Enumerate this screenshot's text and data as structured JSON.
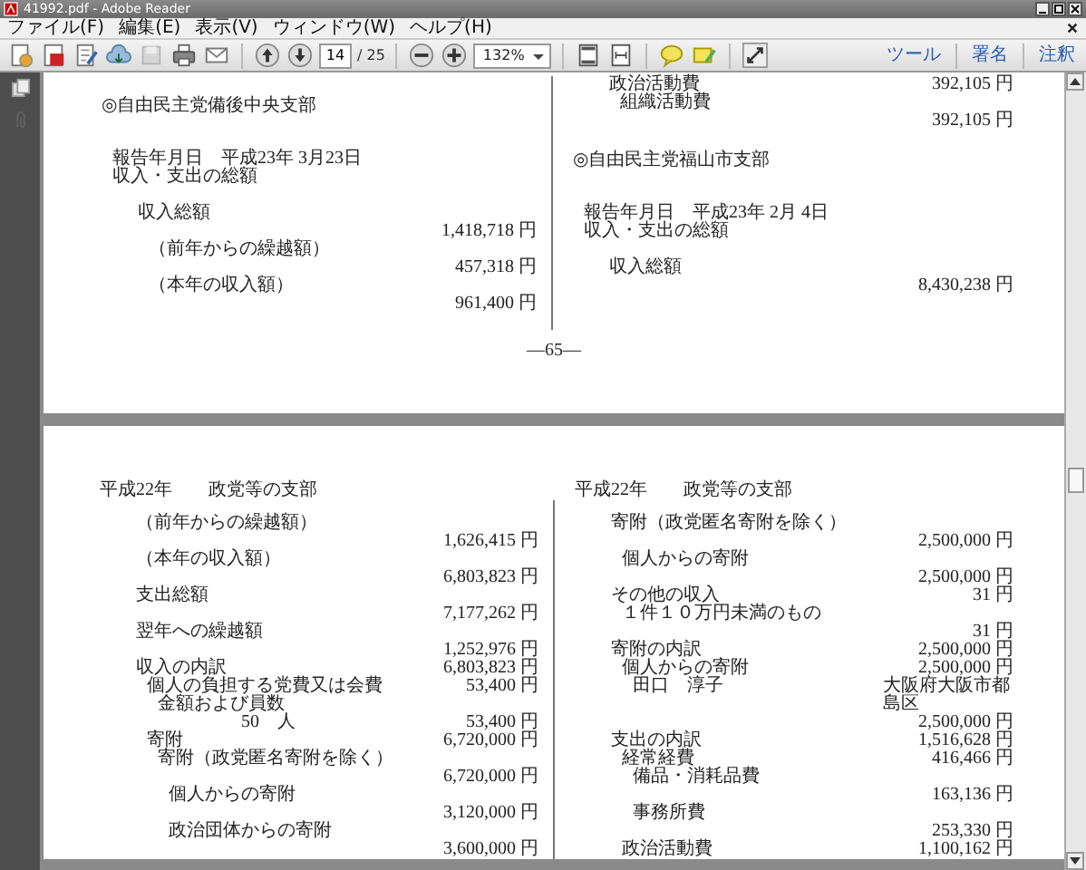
{
  "window": {
    "title": "41992.pdf - Adobe Reader"
  },
  "menu": [
    "ファイル(F)",
    "編集(E)",
    "表示(V)",
    "ウィンドウ(W)",
    "ヘルプ(H)"
  ],
  "toolbar": {
    "page": "14",
    "page_count": "/ 25",
    "zoom": "132%",
    "panes": [
      "ツール",
      "署名",
      "注釈"
    ]
  },
  "pages": [
    {
      "columns": [
        {
          "entries": [
            {
              "kind": "heading",
              "label": "◎自由民主党備後中央支部"
            },
            {
              "kind": "text",
              "label": "報告年月日　平成23年 3月23日"
            },
            {
              "kind": "text",
              "label": "収入・支出の総額"
            },
            {
              "kind": "stacked",
              "label": "収入総額",
              "amount": "1,418,718 円",
              "children": [
                {
                  "kind": "stacked",
                  "label": "（前年からの繰越額）",
                  "amount": "457,318 円"
                },
                {
                  "kind": "stacked",
                  "label": "（本年の収入額）",
                  "amount": "961,400 円"
                }
              ]
            }
          ]
        },
        {
          "entries": [
            {
              "kind": "inline",
              "label": "政治活動費",
              "amount": "392,105 円",
              "children": [
                {
                  "kind": "stacked",
                  "label": "組織活動費",
                  "amount": "392,105 円"
                }
              ]
            },
            {
              "kind": "heading",
              "label": "◎自由民主党福山市支部"
            },
            {
              "kind": "text",
              "label": "報告年月日　平成23年 2月 4日"
            },
            {
              "kind": "text",
              "label": "収入・支出の総額"
            },
            {
              "kind": "stacked",
              "label": "収入総額",
              "amount": "8,430,238 円"
            }
          ]
        }
      ],
      "page_number": "—65—"
    },
    {
      "columns": [
        {
          "entries": [
            {
              "kind": "heading",
              "label": "平成22年　　政党等の支部"
            },
            {
              "kind": "stacked",
              "label": "（前年からの繰越額）",
              "amount": "1,626,415 円"
            },
            {
              "kind": "stacked",
              "label": "（本年の収入額）",
              "amount": "6,803,823 円"
            },
            {
              "kind": "stacked",
              "label": "支出総額",
              "amount": "7,177,262 円"
            },
            {
              "kind": "stacked",
              "label": "翌年への繰越額",
              "amount": "1,252,976 円"
            },
            {
              "kind": "inline",
              "label": "収入の内訳",
              "amount": "6,803,823 円",
              "children": [
                {
                  "kind": "inline",
                  "label": "個人の負担する党費又は会費",
                  "amount": "53,400 円",
                  "children": [
                    {
                      "kind": "label",
                      "label": "金額および員数",
                      "children": [
                        {
                          "kind": "inline",
                          "label": "50　人",
                          "amount": "53,400 円"
                        }
                      ]
                    }
                  ]
                },
                {
                  "kind": "inline",
                  "label": "寄附",
                  "amount": "6,720,000 円",
                  "children": [
                    {
                      "kind": "stacked",
                      "label": "寄附（政党匿名寄附を除く）",
                      "amount": "6,720,000 円",
                      "children": [
                        {
                          "kind": "stacked",
                          "label": "個人からの寄附",
                          "amount": "3,120,000 円"
                        },
                        {
                          "kind": "stacked",
                          "label": "政治団体からの寄附",
                          "amount": "3,600,000 円"
                        }
                      ]
                    }
                  ]
                }
              ]
            }
          ]
        },
        {
          "entries": [
            {
              "kind": "heading",
              "label": "平成22年　　政党等の支部"
            },
            {
              "kind": "stacked",
              "label": "寄附（政党匿名寄附を除く）",
              "amount": "2,500,000 円",
              "children": [
                {
                  "kind": "stacked",
                  "label": "個人からの寄附",
                  "amount": "2,500,000 円"
                }
              ]
            },
            {
              "kind": "inline",
              "label": "その他の収入",
              "amount": "31 円",
              "children": [
                {
                  "kind": "stacked",
                  "label": "１件１０万円未満のもの",
                  "amount": "31 円"
                }
              ]
            },
            {
              "kind": "inline",
              "label": "寄附の内訳",
              "amount": "2,500,000 円",
              "children": [
                {
                  "kind": "inline",
                  "label": "個人からの寄附",
                  "amount": "2,500,000 円",
                  "children": [
                    {
                      "kind": "stacked",
                      "label": "田口　淳子",
                      "note": "大阪府大阪市都島区",
                      "amount": "2,500,000 円"
                    }
                  ]
                }
              ]
            },
            {
              "kind": "inline",
              "label": "支出の内訳",
              "amount": "1,516,628 円",
              "children": [
                {
                  "kind": "inline",
                  "label": "経常経費",
                  "amount": "416,466 円",
                  "children": [
                    {
                      "kind": "stacked",
                      "label": "備品・消耗品費",
                      "amount": "163,136 円"
                    },
                    {
                      "kind": "stacked",
                      "label": "事務所費",
                      "amount": "253,330 円"
                    }
                  ]
                },
                {
                  "kind": "inline",
                  "label": "政治活動費",
                  "amount": "1,100,162 円"
                }
              ]
            }
          ]
        }
      ]
    }
  ]
}
